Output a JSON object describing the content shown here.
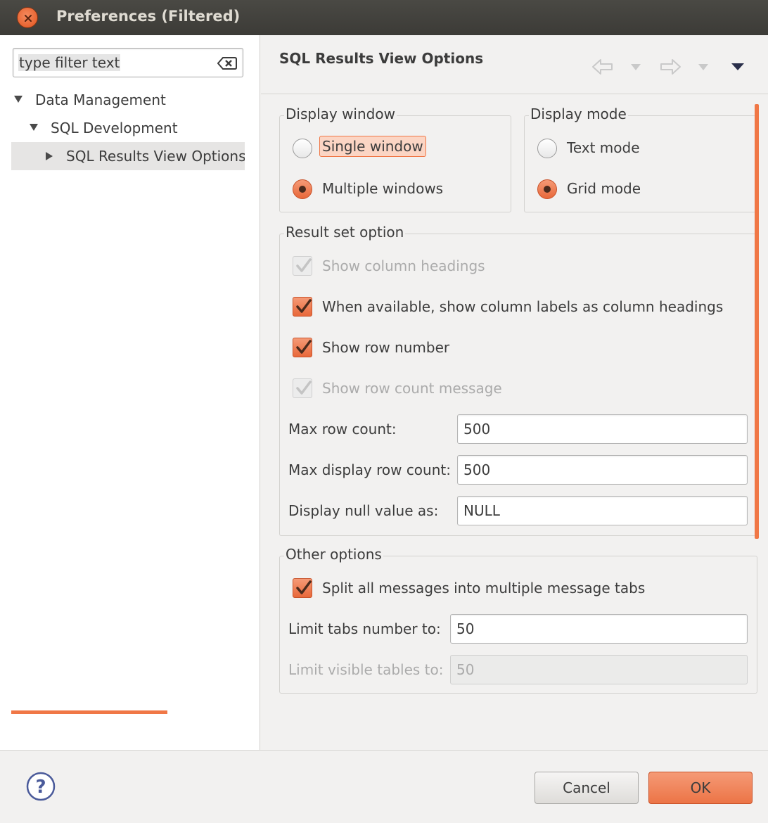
{
  "window": {
    "title": "Preferences (Filtered)"
  },
  "sidebar": {
    "filter_value": "type filter text",
    "tree": [
      {
        "label": "Data Management",
        "expanded": true
      },
      {
        "label": "SQL Development",
        "expanded": true
      },
      {
        "label": "SQL Results View Options",
        "expanded": false,
        "selected": true
      }
    ]
  },
  "page": {
    "title": "SQL Results View Options"
  },
  "display_window": {
    "title": "Display window",
    "options": [
      {
        "label": "Single window",
        "selected": false,
        "focused": true
      },
      {
        "label": "Multiple windows",
        "selected": true
      }
    ]
  },
  "display_mode": {
    "title": "Display mode",
    "options": [
      {
        "label": "Text mode",
        "selected": false
      },
      {
        "label": "Grid mode",
        "selected": true
      }
    ]
  },
  "result_set": {
    "title": "Result set option",
    "checkboxes": [
      {
        "label": "Show column headings",
        "checked": true,
        "enabled": false
      },
      {
        "label": "When available, show column labels as column headings",
        "checked": true,
        "enabled": true
      },
      {
        "label": "Show row number",
        "checked": true,
        "enabled": true
      },
      {
        "label": "Show row count message",
        "checked": true,
        "enabled": false
      }
    ],
    "fields": [
      {
        "label": "Max row count:",
        "value": "500"
      },
      {
        "label": "Max display row count:",
        "value": "500"
      },
      {
        "label": "Display null value as:",
        "value": "NULL"
      }
    ]
  },
  "other_options": {
    "title": "Other options",
    "checkboxes": [
      {
        "label": "Split all messages into multiple message tabs",
        "checked": true,
        "enabled": true
      }
    ],
    "fields": [
      {
        "label": "Limit tabs number to:",
        "value": "50",
        "enabled": true
      },
      {
        "label": "Limit visible tables to:",
        "value": "50",
        "enabled": false
      }
    ]
  },
  "buttons": {
    "cancel": "Cancel",
    "ok": "OK"
  },
  "colors": {
    "accent": "#f07746",
    "titlebar": "#3c3b37",
    "background": "#f2f1f0"
  },
  "icons": [
    "close-icon",
    "clear-filter-icon",
    "back-icon",
    "forward-icon",
    "menu-icon",
    "help-icon",
    "checkmark-icon"
  ]
}
